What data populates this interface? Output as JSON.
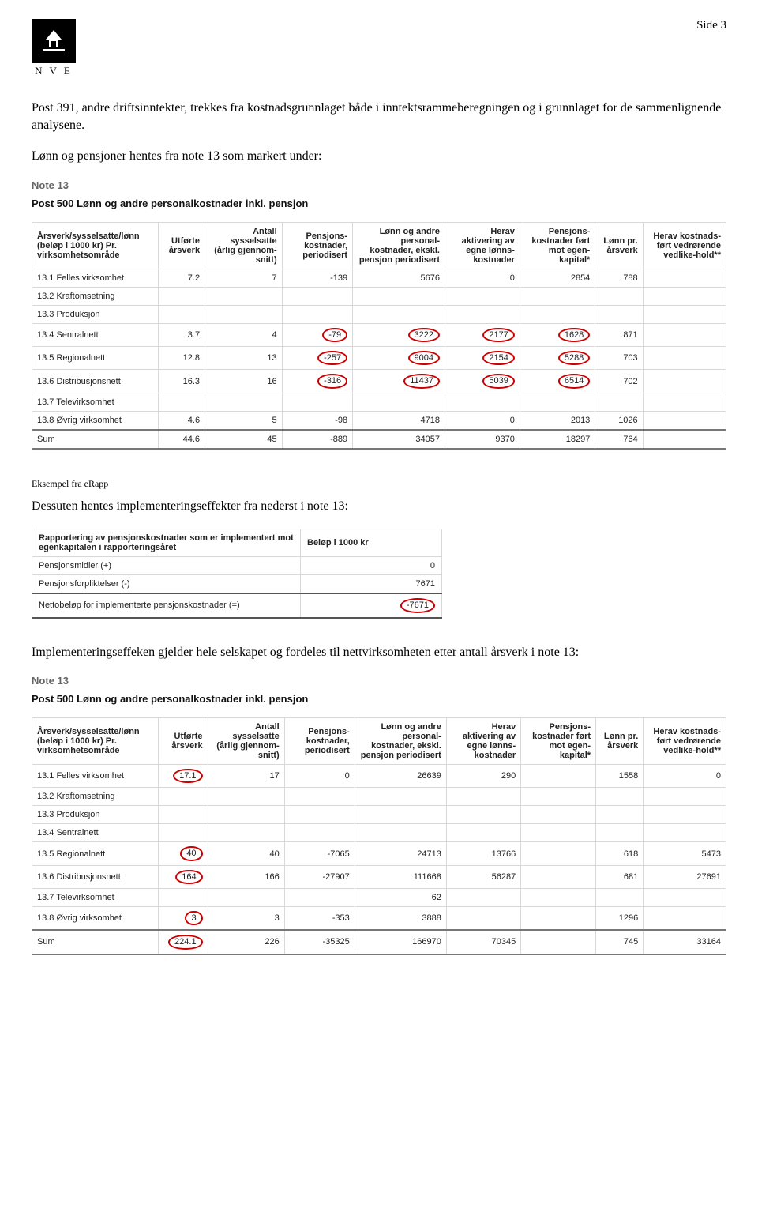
{
  "header": {
    "page_label": "Side 3",
    "org_letters": "N V E"
  },
  "paragraphs": {
    "p1": "Post 391, andre driftsinntekter, trekkes fra kostnadsgrunnlaget både i inntektsrammeberegningen og i grunnlaget for de sammenlignende analysene.",
    "p2": "Lønn og pensjoner hentes fra note 13 som markert under:",
    "caption1": "Eksempel fra eRapp",
    "p3": "Dessuten hentes implementeringseffekter fra nederst i note 13:",
    "p4": "Implementeringseffeken gjelder hele selskapet og fordeles til nettvirksomheten etter antall årsverk i note 13:"
  },
  "note13": {
    "title": "Note 13",
    "subtitle": "Post 500 Lønn og andre personalkostnader inkl. pensjon",
    "headers": {
      "c0": "Årsverk/sysselsatte/lønn (beløp i 1000 kr)\nPr. virksomhetsområde",
      "c1": "Utførte årsverk",
      "c2": "Antall sysselsatte (årlig gjennom-snitt)",
      "c3": "Pensjons-kostnader, periodisert",
      "c4": "Lønn og andre personal-kostnader, ekskl. pensjon periodisert",
      "c5": "Herav aktivering av egne lønns-kostnader",
      "c6": "Pensjons-kostnader ført mot egen-kapital*",
      "c7": "Lønn pr. årsverk",
      "c8": "Herav kostnads-ført vedrørende vedlike-hold**"
    },
    "row_labels": {
      "r1": "13.1 Felles virksomhet",
      "r2": "13.2 Kraftomsetning",
      "r3": "13.3 Produksjon",
      "r4": "13.4 Sentralnett",
      "r5": "13.5 Regionalnett",
      "r6": "13.6 Distribusjonsnett",
      "r7": "13.7 Televirksomhet",
      "r8": "13.8 Øvrig virksomhet",
      "sum": "Sum"
    },
    "table1": {
      "r1": {
        "c1": "7.2",
        "c2": "7",
        "c3": "-139",
        "c4": "5676",
        "c5": "0",
        "c6": "2854",
        "c7": "788",
        "c8": ""
      },
      "r4": {
        "c1": "3.7",
        "c2": "4",
        "c3": "-79",
        "c4": "3222",
        "c5": "2177",
        "c6": "1628",
        "c7": "871",
        "c8": ""
      },
      "r5": {
        "c1": "12.8",
        "c2": "13",
        "c3": "-257",
        "c4": "9004",
        "c5": "2154",
        "c6": "5288",
        "c7": "703",
        "c8": ""
      },
      "r6": {
        "c1": "16.3",
        "c2": "16",
        "c3": "-316",
        "c4": "11437",
        "c5": "5039",
        "c6": "6514",
        "c7": "702",
        "c8": ""
      },
      "r8": {
        "c1": "4.6",
        "c2": "5",
        "c3": "-98",
        "c4": "4718",
        "c5": "0",
        "c6": "2013",
        "c7": "1026",
        "c8": ""
      },
      "sum": {
        "c1": "44.6",
        "c2": "45",
        "c3": "-889",
        "c4": "34057",
        "c5": "9370",
        "c6": "18297",
        "c7": "764",
        "c8": ""
      }
    },
    "table3": {
      "r1": {
        "c1": "17.1",
        "c2": "17",
        "c3": "0",
        "c4": "26639",
        "c5": "290",
        "c6": "",
        "c7": "1558",
        "c8": "0"
      },
      "r5": {
        "c1": "40",
        "c2": "40",
        "c3": "-7065",
        "c4": "24713",
        "c5": "13766",
        "c6": "",
        "c7": "618",
        "c8": "5473"
      },
      "r6": {
        "c1": "164",
        "c2": "166",
        "c3": "-27907",
        "c4": "111668",
        "c5": "56287",
        "c6": "",
        "c7": "681",
        "c8": "27691"
      },
      "r7": {
        "c1": "",
        "c2": "",
        "c3": "",
        "c4": "62",
        "c5": "",
        "c6": "",
        "c7": "",
        "c8": ""
      },
      "r8": {
        "c1": "3",
        "c2": "3",
        "c3": "-353",
        "c4": "3888",
        "c5": "",
        "c6": "",
        "c7": "1296",
        "c8": ""
      },
      "sum": {
        "c1": "224.1",
        "c2": "226",
        "c3": "-35325",
        "c4": "166970",
        "c5": "70345",
        "c6": "",
        "c7": "745",
        "c8": "33164"
      }
    }
  },
  "impl_table": {
    "title": "Rapportering av pensjonskostnader som er implementert mot egenkapitalen i rapporteringsåret",
    "col": "Beløp i 1000 kr",
    "r1": {
      "label": "Pensjonsmidler (+)",
      "val": "0"
    },
    "r2": {
      "label": "Pensjonsforpliktelser (-)",
      "val": "7671"
    },
    "r3": {
      "label": "Nettobeløp for implementerte pensjonskostnader (=)",
      "val": "-7671"
    }
  }
}
